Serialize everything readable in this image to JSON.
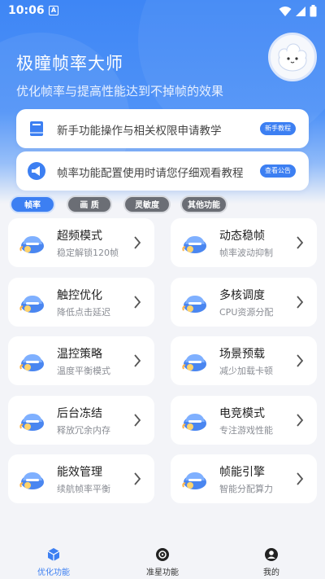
{
  "status_bar": {
    "time": "10:06",
    "app_indicator": "A"
  },
  "header": {
    "title": "极瞳帧率大师",
    "subtitle": "优化帧率与提高性能达到不掉帧的效果",
    "avatar_icon": "cloud-mascot-avatar"
  },
  "notices": [
    {
      "icon": "book-icon",
      "text": "新手功能操作与相关权限申请教学",
      "button": "新手教程"
    },
    {
      "icon": "megaphone-icon",
      "text": "帧率功能配置使用时请您仔细观看教程",
      "button": "查看公告"
    }
  ],
  "tabs": [
    {
      "label": "帧率",
      "active": true
    },
    {
      "label": "画 质",
      "active": false
    },
    {
      "label": "灵敏度",
      "active": false
    },
    {
      "label": "其他功能",
      "active": false
    }
  ],
  "features": [
    {
      "title": "超频模式",
      "desc": "稳定解锁120帧"
    },
    {
      "title": "动态稳帧",
      "desc": "帧率波动抑制"
    },
    {
      "title": "触控优化",
      "desc": "降低点击延迟"
    },
    {
      "title": "多核调度",
      "desc": "CPU资源分配"
    },
    {
      "title": "温控策略",
      "desc": "温度平衡模式"
    },
    {
      "title": "场景预载",
      "desc": "减少加载卡顿"
    },
    {
      "title": "后台冻结",
      "desc": "释放冗余内存"
    },
    {
      "title": "电竞模式",
      "desc": "专注游戏性能"
    },
    {
      "title": "能效管理",
      "desc": "续航帧率平衡"
    },
    {
      "title": "帧能引擎",
      "desc": "智能分配算力"
    }
  ],
  "bottom_nav": [
    {
      "label": "优化功能",
      "icon": "cube-icon",
      "active": true
    },
    {
      "label": "准星功能",
      "icon": "crosshair-icon",
      "active": false
    },
    {
      "label": "我的",
      "icon": "user-icon",
      "active": false
    }
  ],
  "colors": {
    "primary": "#3c7ff2",
    "tab_inactive": "#6b6e75",
    "background": "#f3f4f8"
  }
}
